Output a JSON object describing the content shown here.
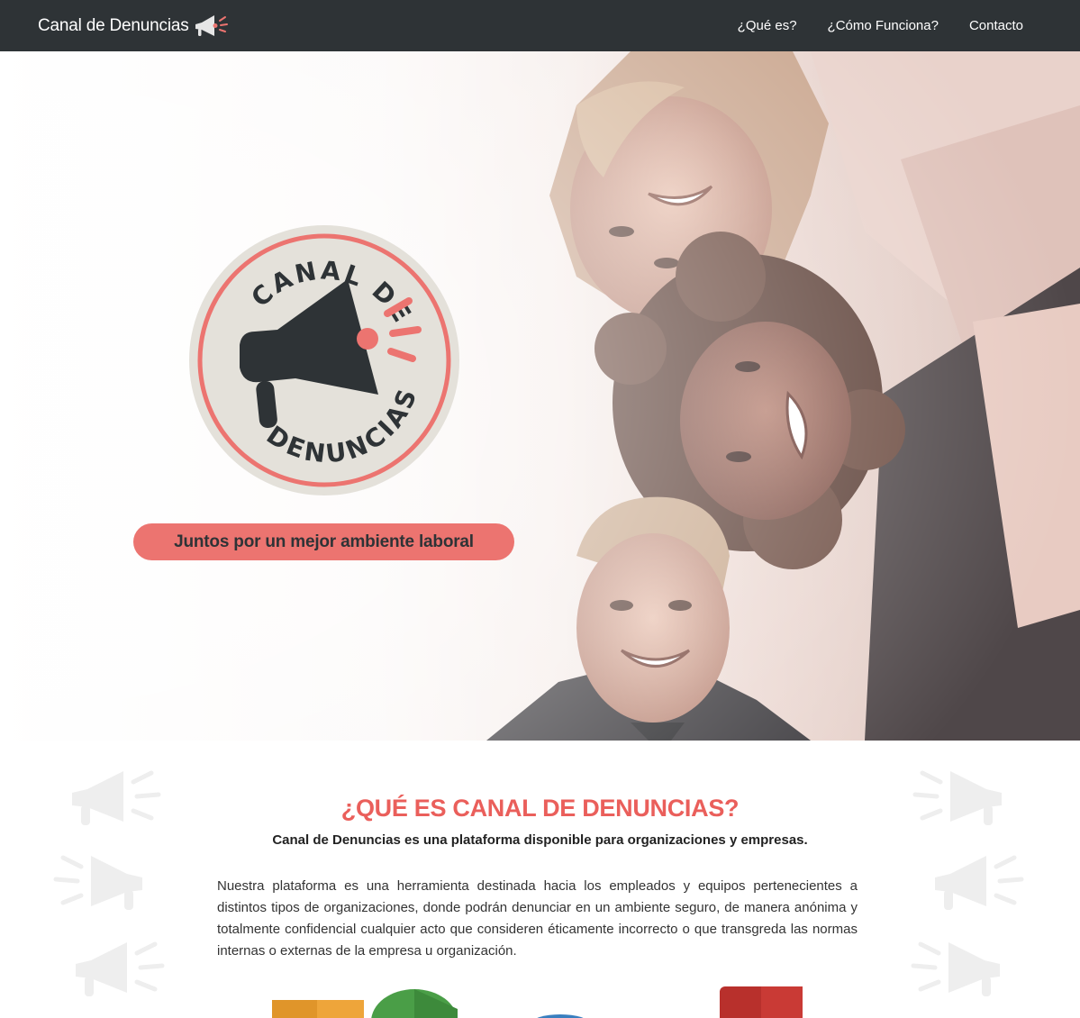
{
  "navbar": {
    "brand": "Canal de Denuncias",
    "brand_icon": "megaphone-icon",
    "links": [
      {
        "label": "¿Qué es?"
      },
      {
        "label": "¿Cómo Funciona?"
      },
      {
        "label": "Contacto"
      }
    ]
  },
  "hero": {
    "logo": {
      "top_text": "CANAL DE",
      "bottom_text": "DENUNCIAS",
      "icon": "megaphone-icon"
    },
    "tagline": "Juntos por un mejor ambiente laboral"
  },
  "about": {
    "title": "¿QUÉ ES CANAL DE DENUNCIAS?",
    "subtitle": "Canal de Denuncias es una plataforma disponible para organizaciones y empresas.",
    "body": "Nuestra plataforma es una herramienta destinada hacia los empleados y equipos pertenecientes a distintos tipos de organizaciones, donde podrán denunciar en un ambiente seguro, de manera anónima y totalmente confidencial cualquier acto que consideren éticamente incorrecto o que transgreda las normas internas o externas de la empresa u organización."
  },
  "colors": {
    "navbar_bg": "#2e3336",
    "accent": "#ea5f5b",
    "pill": "#ec7470",
    "logo_bg": "#e4e1da",
    "dark": "#2e3336"
  }
}
